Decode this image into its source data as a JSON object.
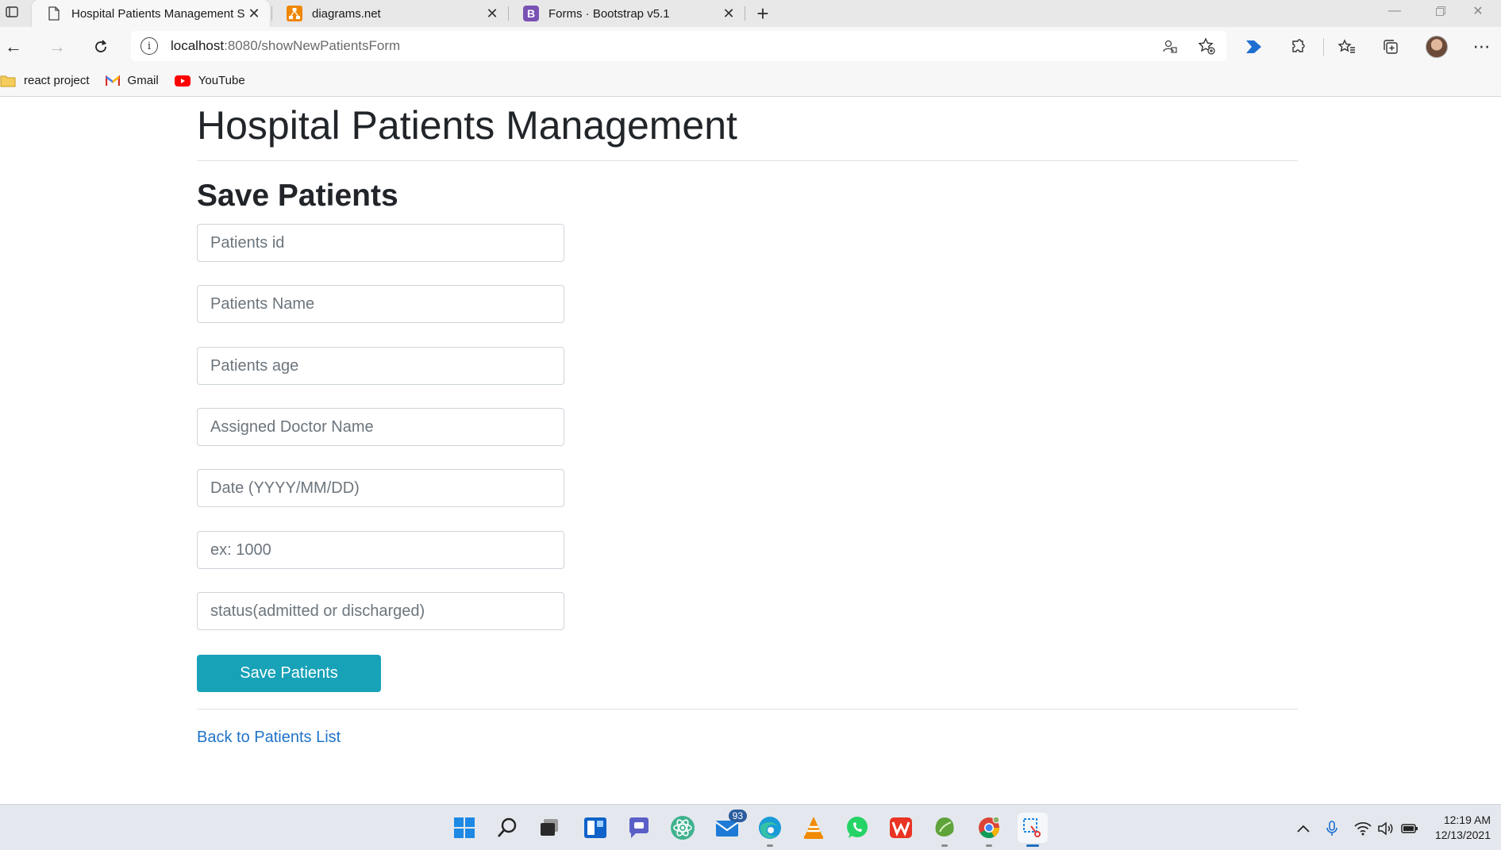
{
  "browser": {
    "tabs": [
      {
        "title": "Hospital Patients Management S",
        "favicon": "page-icon",
        "active": true
      },
      {
        "title": "diagrams.net",
        "favicon": "diagrams-icon",
        "active": false
      },
      {
        "title": "Forms · Bootstrap v5.1",
        "favicon": "bootstrap-icon",
        "active": false
      }
    ],
    "address": {
      "host": "localhost",
      "path": ":8080/showNewPatientsForm"
    },
    "bookmarks": [
      {
        "label": "react project",
        "icon": "folder-icon"
      },
      {
        "label": "Gmail",
        "icon": "gmail-icon"
      },
      {
        "label": "YouTube",
        "icon": "youtube-icon"
      }
    ]
  },
  "page": {
    "title": "Hospital Patients Management",
    "section_title": "Save Patients",
    "fields": {
      "patient_id": {
        "placeholder": "Patients id",
        "value": ""
      },
      "patient_name": {
        "placeholder": "Patients Name",
        "value": ""
      },
      "patient_age": {
        "placeholder": "Patients age",
        "value": ""
      },
      "doctor_name": {
        "placeholder": "Assigned Doctor Name",
        "value": ""
      },
      "date": {
        "placeholder": "Date (YYYY/MM/DD)",
        "value": ""
      },
      "amount": {
        "placeholder": "ex: 1000",
        "value": ""
      },
      "status": {
        "placeholder": "status(admitted or discharged)",
        "value": ""
      }
    },
    "save_button": "Save Patients",
    "back_link": "Back to Patients List"
  },
  "taskbar": {
    "mail_badge": "93",
    "time": "12:19 AM",
    "date": "12/13/2021"
  },
  "colors": {
    "accent_button": "#17a2b8",
    "link": "#1f73c8",
    "text": "#212529"
  }
}
